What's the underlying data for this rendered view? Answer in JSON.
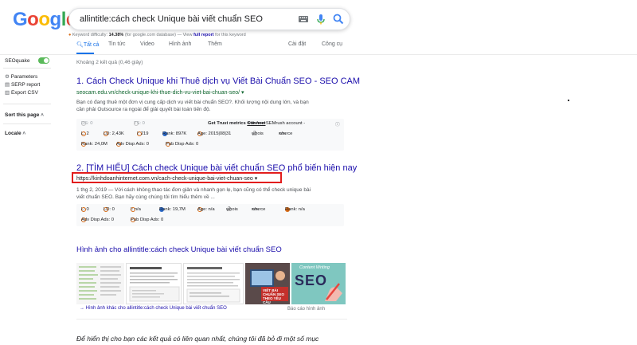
{
  "logo": {
    "text": "Google",
    "colors": [
      "#4285f4",
      "#ea4335",
      "#fbbc05",
      "#4285f4",
      "#34a853",
      "#ea4335"
    ]
  },
  "search": {
    "value": "allintitle:cách check Unique bài viết chuẩn SEO",
    "icons": [
      "keyboard-icon",
      "mic-icon",
      "search-icon"
    ]
  },
  "keyword_difficulty": {
    "label": "Keyword difficulty:",
    "value": "14.38%",
    "database": "(for google.com database)",
    "sep": "— View",
    "link": "full report",
    "suffix": "for this keyword"
  },
  "tabs": {
    "all": "Tất cả",
    "news": "Tin tức",
    "videos": "Video",
    "images": "Hình ảnh",
    "more": "Thêm",
    "settings": "Cài đặt",
    "tools": "Công cụ"
  },
  "sidebar": {
    "seoquake": "SEOquake",
    "parameters": "Parameters",
    "serp_report": "SERP report",
    "export_csv": "Export CSV",
    "sort": "Sort this page",
    "locale": "Locale"
  },
  "results_count": "Khoảng 2 kết quả (0,46 giây)",
  "results": [
    {
      "title": "1. Cách Check Unique khi Thuê dịch vụ Viết Bài Chuẩn SEO - SEO CAM",
      "url": "seocam.edu.vn/check-unique-khi-thue-dich-vu-viet-bai-chuan-seo/",
      "snippet": [
        "Bạn có đang thuê một đơn vị cung cấp dịch vụ viết bài chuẩn SEO?. Khối lượng nội dung lớn, và bạn",
        "cần phải Outsource ra ngoài để giải quyết bài toán tiến độ."
      ],
      "metrics": {
        "row1": {
          "ds": "DS: 0",
          "ts": "TS: 0",
          "trust": "Get Trust metrics",
          "semrush": "with free SEMrush account -",
          "connect": "Connect"
        },
        "row2": {
          "l": "L: 2",
          "ld": "LD: 2,43K",
          "i": "I: 219",
          "rank": "Rank: 897K",
          "age": "Age: 2015|08|31",
          "whois": "whois",
          "source": "source"
        },
        "row3": {
          "rank": "Rank: 24,0M",
          "adv": "Adv Disp Ads: 0",
          "pub": "Pub Disp Ads: 0"
        }
      }
    },
    {
      "title": "2. [TÌM HIỂU] Cách check Unique bài viết chuẩn SEO phổ biến hiện nay",
      "url": "https://kinhdoanhinternet.com.vn/cach-check-unique-bai-viet-chuan-seo",
      "snippet": [
        "1 thg 2, 2019 — Với cách không thao tác đơn giản và nhanh gọn lẹ, bạn cũng có thể check unique bài",
        "viết chuẩn SEO. Bạn hãy cùng chúng tôi tìm hiểu thêm về ..."
      ],
      "metrics": {
        "row1": {
          "l": "L: 0",
          "ld": "LD: 0",
          "i": "I: n/a",
          "rank": "Rank: 19,7M",
          "age": "Age: n/a",
          "whois": "whois",
          "source": "source",
          "rank2": "Rank: n/a"
        },
        "row2": {
          "adv": "Adv Disp Ads: 0",
          "pub": "Pub Disp Ads: 0"
        }
      }
    }
  ],
  "images": {
    "title": "Hình ảnh cho allintitle:cách check Unique bài viết chuẩn SEO",
    "thumb_labels": {
      "writing_top": "Content Writing",
      "writing_big": "SEO",
      "theo_yeu_cau": "VIẾT BÀI CHUẨN SEO THEO YÊU CẦU"
    },
    "more": "Hình ảnh khác cho allintitle:cách check Unique bài viết chuẩn SEO",
    "report": "Báo cáo hình ảnh"
  },
  "omitted": "Để hiển thị cho bạn các kết quả có liên quan nhất, chúng tôi đã bỏ đi một số mục",
  "colors": {
    "link": "#1a0dab",
    "url": "#0d652d",
    "accent": "#1a73e8",
    "highlight": "#e21d1d",
    "seoquake_on": "#5aba5a"
  }
}
